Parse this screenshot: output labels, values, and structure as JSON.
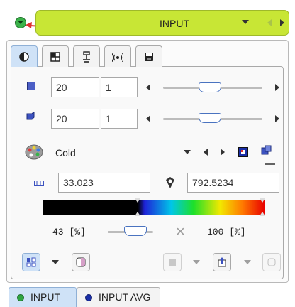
{
  "header": {
    "title": "INPUT"
  },
  "tabs": [
    {
      "icon": "contrast-icon"
    },
    {
      "icon": "grid-icon"
    },
    {
      "icon": "microscope-icon"
    },
    {
      "icon": "signal-icon"
    },
    {
      "icon": "save-icon"
    }
  ],
  "rows": [
    {
      "icon": "plane-icon",
      "value1": "20",
      "value2": "1",
      "slider": 0.47
    },
    {
      "icon": "cube-icon",
      "value1": "20",
      "value2": "1",
      "slider": 0.47
    }
  ],
  "colormap": {
    "label": "Cold"
  },
  "range": {
    "min": "33.023",
    "max": "792.5234"
  },
  "threshold": {
    "low": "43 [%]",
    "high": "100 [%]",
    "close_glyph": "×"
  },
  "bottom_tabs": [
    {
      "label": "INPUT",
      "color": "#2fa541"
    },
    {
      "label": "INPUT AVG",
      "color": "#1b2fa8"
    }
  ],
  "colors": {
    "header": "#c8e635",
    "arrow": "#e03030",
    "active_tab": "#cfe2f7"
  }
}
